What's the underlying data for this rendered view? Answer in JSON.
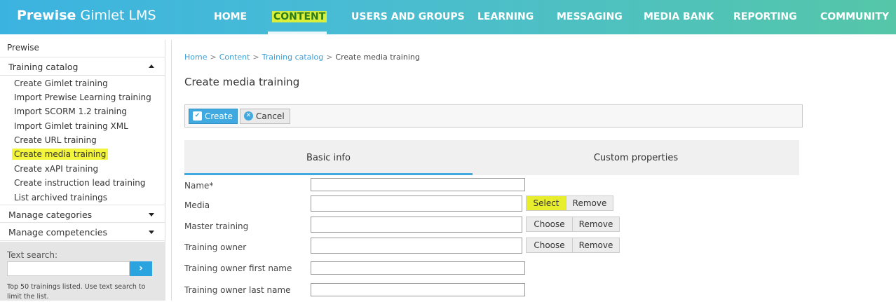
{
  "app": {
    "brand_bold": "Prewise",
    "brand_light": "Gimlet LMS"
  },
  "nav": {
    "items": [
      {
        "label": "HOME"
      },
      {
        "label": "CONTENT"
      },
      {
        "label": "USERS AND GROUPS"
      },
      {
        "label": "LEARNING"
      },
      {
        "label": "MESSAGING"
      },
      {
        "label": "MEDIA BANK"
      },
      {
        "label": "REPORTING"
      },
      {
        "label": "COMMUNITY"
      }
    ]
  },
  "sidebar": {
    "header": "Prewise",
    "training_catalog": "Training catalog",
    "links": [
      "Create Gimlet training",
      "Import Prewise Learning training",
      "Import SCORM 1.2 training",
      "Import Gimlet training XML",
      "Create URL training",
      "Create media training",
      "Create xAPI training",
      "Create instruction lead training",
      "List archived trainings"
    ],
    "manage_categories": "Manage categories",
    "manage_competencies": "Manage competencies",
    "search_label": "Text search:",
    "search_button": "›",
    "search_note": "Top 50 trainings listed. Use text search to limit the list."
  },
  "breadcrumb": {
    "home": "Home",
    "content": "Content",
    "catalog": "Training catalog",
    "current": "Create media training",
    "sep": ">"
  },
  "page": {
    "title": "Create media training"
  },
  "toolbar": {
    "create": "Create",
    "cancel": "Cancel",
    "create_icon": "✔",
    "cancel_icon": "✕"
  },
  "tabs": {
    "basic": "Basic info",
    "custom": "Custom properties"
  },
  "form": {
    "name_label": "Name*",
    "media_label": "Media",
    "master_label": "Master training",
    "owner_label": "Training owner",
    "owner_first_label": "Training owner first name",
    "owner_last_label": "Training owner last name",
    "select": "Select",
    "remove": "Remove",
    "choose": "Choose"
  },
  "colors": {
    "accent": "#3fa9e0",
    "highlight": "#f2f53a",
    "nav_active_bg": "#d9ef3a"
  }
}
